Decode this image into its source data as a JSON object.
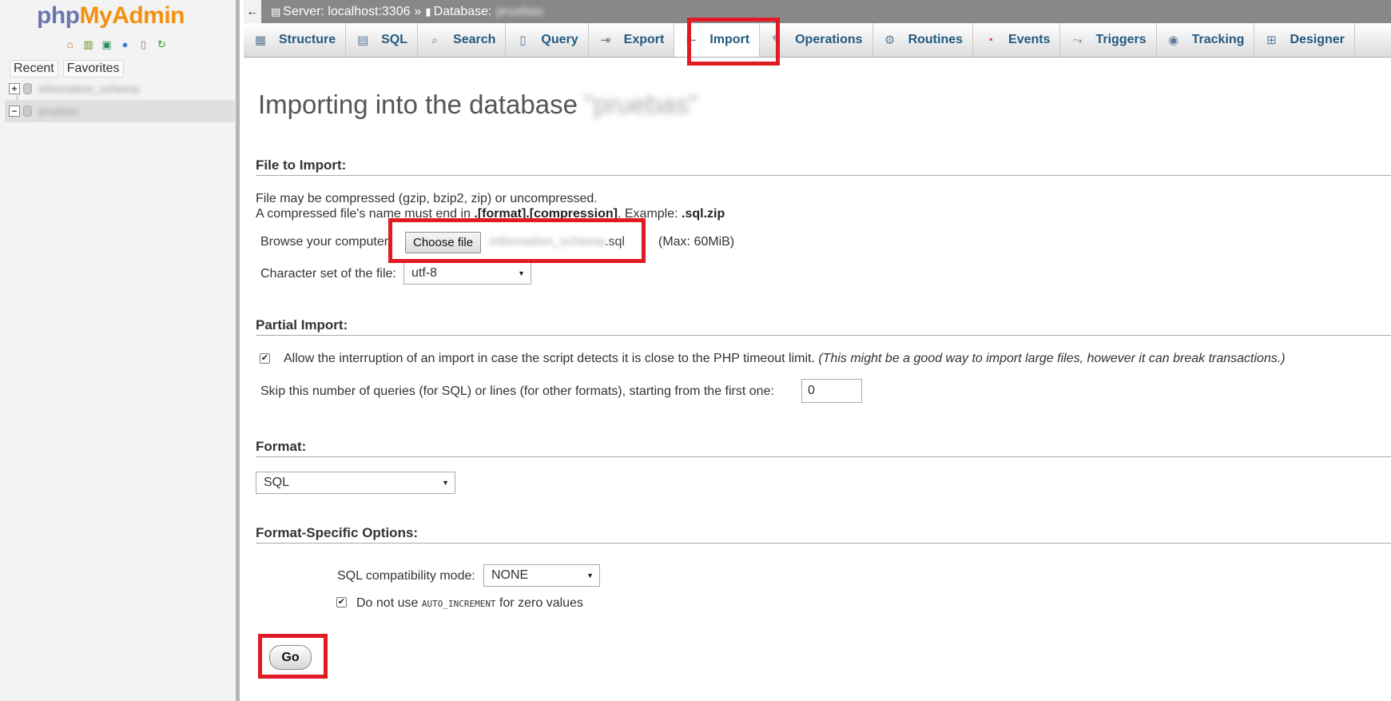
{
  "nav": {
    "logo_php": "php",
    "logo_myadmin": "MyAdmin",
    "icons": [
      "home-icon",
      "exit-icon",
      "query-window-icon",
      "help-icon",
      "documentation-icon",
      "reload-icon"
    ],
    "tabs": {
      "recent": "Recent",
      "favorites": "Favorites"
    },
    "databases": [
      {
        "name": "information_schema",
        "expander": "+"
      },
      {
        "name": "pruebas",
        "expander": "−"
      }
    ]
  },
  "topbar": {
    "back": "←",
    "server_label": "Server: localhost:3306",
    "separator": "»",
    "database_label": "Database:",
    "database_name": "pruebas"
  },
  "tabs": [
    {
      "label": "Structure",
      "icon": "structure-icon"
    },
    {
      "label": "SQL",
      "icon": "sql-icon"
    },
    {
      "label": "Search",
      "icon": "search-icon"
    },
    {
      "label": "Query",
      "icon": "query-icon"
    },
    {
      "label": "Export",
      "icon": "export-icon"
    },
    {
      "label": "Import",
      "icon": "import-icon"
    },
    {
      "label": "Operations",
      "icon": "operations-icon"
    },
    {
      "label": "Routines",
      "icon": "routines-icon"
    },
    {
      "label": "Events",
      "icon": "events-icon"
    },
    {
      "label": "Triggers",
      "icon": "triggers-icon"
    },
    {
      "label": "Tracking",
      "icon": "tracking-icon"
    },
    {
      "label": "Designer",
      "icon": "designer-icon"
    }
  ],
  "active_tab": "Import",
  "main": {
    "title": "Importing into the database",
    "title_db": "\"pruebas\"",
    "file_section": {
      "heading": "File to Import:",
      "compress_note": "File may be compressed (gzip, bzip2, zip) or uncompressed.",
      "name_note_prefix": "A compressed file's name must end in ",
      "name_note_bold": ".[format].[compression]",
      "name_note_mid": ". Example: ",
      "name_note_example": ".sql.zip",
      "browse_label": "Browse your computer:",
      "choose_button": "Choose file",
      "file_name_base": "information_schema",
      "file_name_ext": ".sql",
      "max_size": "(Max: 60MiB)",
      "charset_label": "Character set of the file:",
      "charset_value": "utf-8"
    },
    "partial_section": {
      "heading": "Partial Import:",
      "allow_interrupt_checked": true,
      "allow_interrupt_label": "Allow the interruption of an import in case the script detects it is close to the PHP timeout limit.",
      "allow_interrupt_note": "(This might be a good way to import large files, however it can break transactions.)",
      "skip_label": "Skip this number of queries (for SQL) or lines (for other formats), starting from the first one:",
      "skip_value": "0"
    },
    "format_section": {
      "heading": "Format:",
      "format_value": "SQL"
    },
    "options_section": {
      "heading": "Format-Specific Options:",
      "compat_label": "SQL compatibility mode:",
      "compat_value": "NONE",
      "auto_inc_checked": true,
      "auto_inc_prefix": "Do not use",
      "auto_inc_code": "AUTO_INCREMENT",
      "auto_inc_suffix": "for zero values"
    },
    "go_button": "Go"
  },
  "colors": {
    "highlight": "#e01b24",
    "tab_text": "#235a81",
    "topbar_bg": "#888888",
    "logo_php": "#6c78af",
    "logo_myadmin": "#f29111"
  }
}
